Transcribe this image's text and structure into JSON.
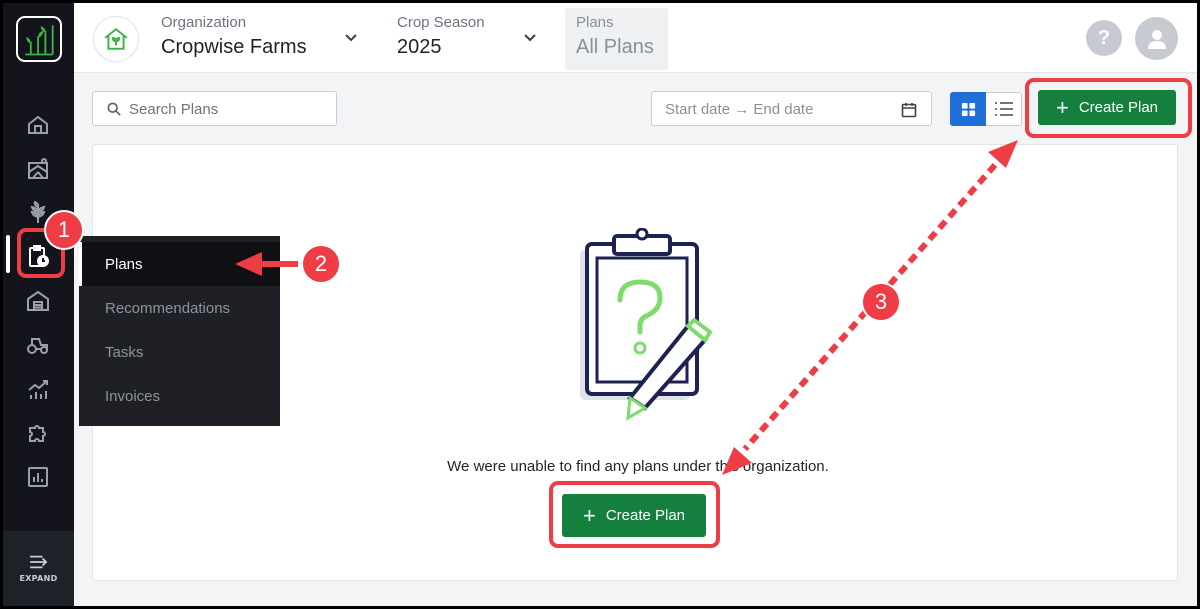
{
  "header": {
    "organization": {
      "label": "Organization",
      "value": "Cropwise Farms"
    },
    "crop_season": {
      "label": "Crop Season",
      "value": "2025"
    },
    "plans": {
      "label": "Plans",
      "value": "All Plans"
    },
    "help_label": "?"
  },
  "sidebar": {
    "items": [
      {
        "name": "home-icon"
      },
      {
        "name": "fields-icon"
      },
      {
        "name": "crop-icon"
      },
      {
        "name": "plans-clipboard-icon"
      },
      {
        "name": "warehouse-icon"
      },
      {
        "name": "tractor-icon"
      },
      {
        "name": "analytics-icon"
      },
      {
        "name": "integrations-puzzle-icon"
      },
      {
        "name": "reports-icon"
      }
    ],
    "expand_label": "EXPAND"
  },
  "flyout": {
    "items": [
      {
        "label": "Plans",
        "active": true
      },
      {
        "label": "Recommendations",
        "active": false
      },
      {
        "label": "Tasks",
        "active": false
      },
      {
        "label": "Invoices",
        "active": false
      }
    ]
  },
  "toolbar": {
    "search_placeholder": "Search Plans",
    "date_range_placeholder": "Start date → End date",
    "create_plan_label": "Create Plan"
  },
  "empty_state": {
    "message": "We were unable to find any plans under this organization.",
    "create_plan_label": "Create Plan"
  },
  "annotations": {
    "badges": [
      "1",
      "2",
      "3"
    ],
    "color": "#ef3d45"
  },
  "colors": {
    "primary_green": "#15803d",
    "sidebar_bg": "#14151c",
    "accent_blue": "#1f6fd6"
  }
}
